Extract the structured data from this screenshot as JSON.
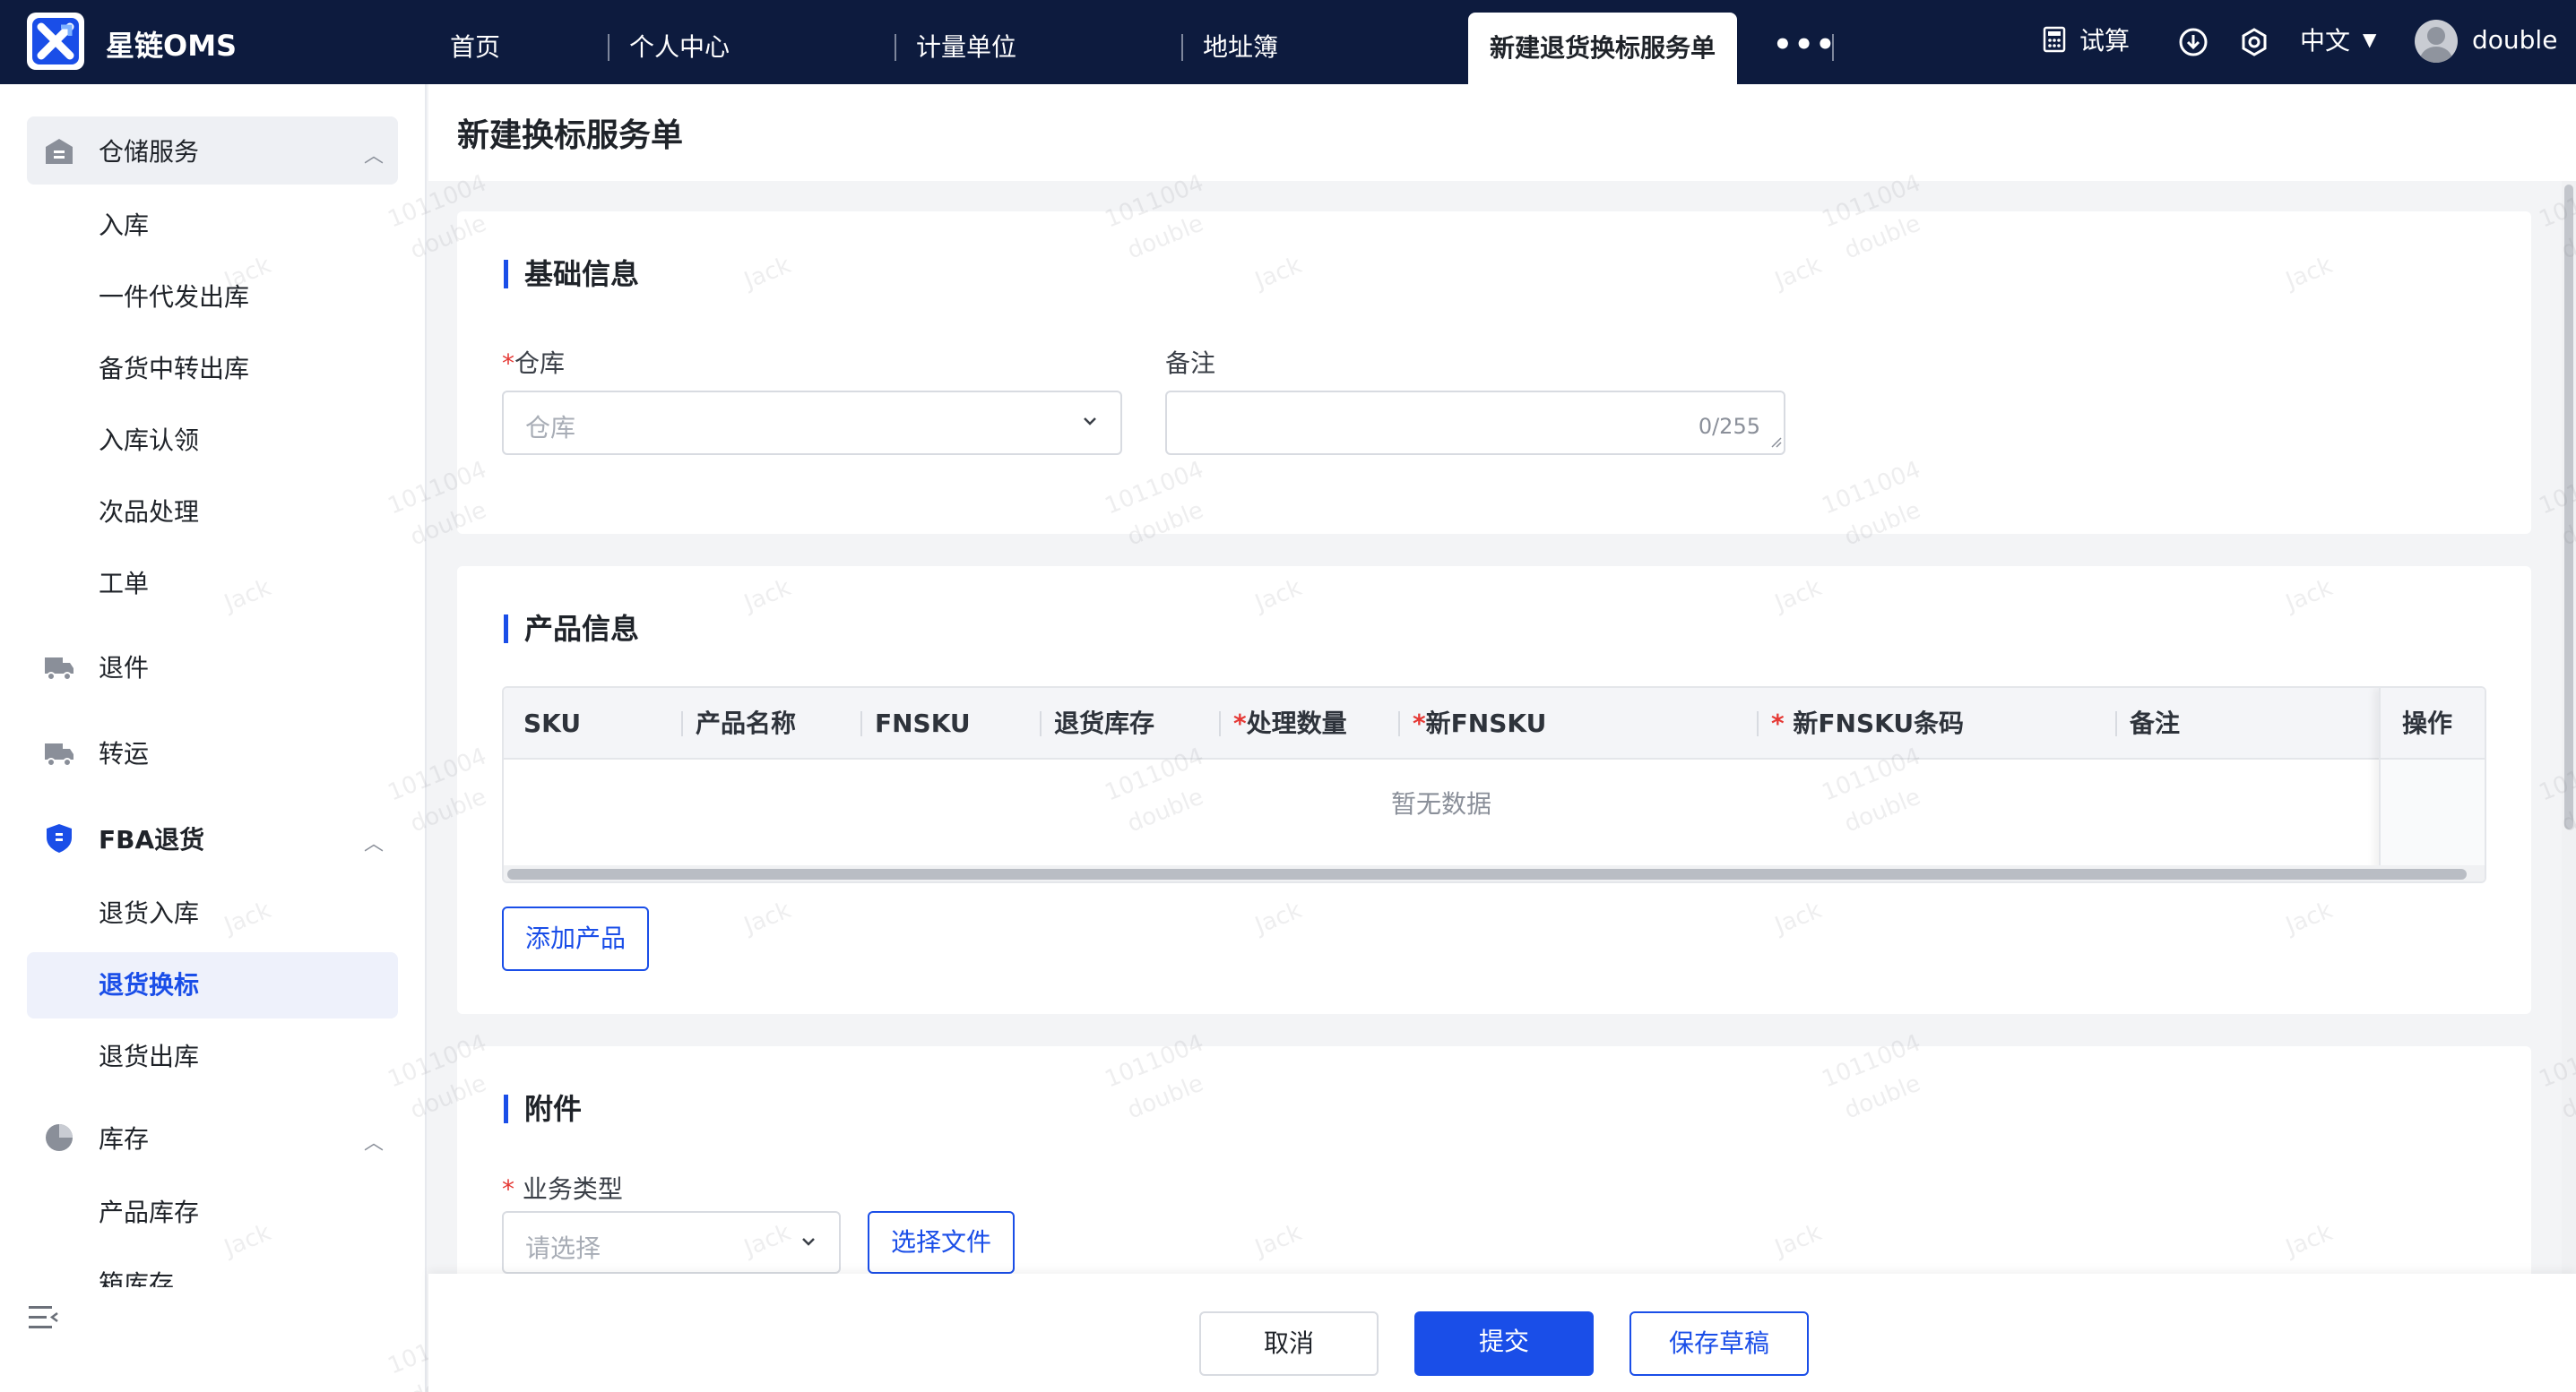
{
  "app": {
    "name": "星链OMS"
  },
  "nav": {
    "tabs": [
      "首页",
      "个人中心",
      "计量单位",
      "地址簿"
    ],
    "active_tab": "新建退货换标服务单",
    "more": "•••"
  },
  "topbar": {
    "calc_label": "试算",
    "language": "中文",
    "username": "double"
  },
  "sidebar": {
    "groups": [
      {
        "label": "仓储服务",
        "items": [
          "入库",
          "一件代发出库",
          "备货中转出库",
          "入库认领",
          "次品处理",
          "工单"
        ]
      },
      {
        "label": "退件"
      },
      {
        "label": "转运"
      },
      {
        "label": "FBA退货",
        "items": [
          "退货入库",
          "退货换标",
          "退货出库"
        ]
      },
      {
        "label": "库存",
        "items": [
          "产品库存",
          "箱库存"
        ]
      }
    ],
    "active_item": "退货换标"
  },
  "page": {
    "title": "新建换标服务单"
  },
  "basic": {
    "title": "基础信息",
    "warehouse_label": "仓库",
    "warehouse_placeholder": "仓库",
    "remark_label": "备注",
    "remark_counter": "0/255"
  },
  "product": {
    "title": "产品信息",
    "columns": [
      "SKU",
      "产品名称",
      "FNSKU",
      "退货库存",
      "处理数量",
      "新FNSKU",
      "新FNSKU条码",
      "备注",
      "操作"
    ],
    "empty_text": "暂无数据",
    "add_button": "添加产品"
  },
  "attachment": {
    "title": "附件",
    "type_label": "业务类型",
    "type_placeholder": "请选择",
    "file_button": "选择文件"
  },
  "footer": {
    "cancel": "取消",
    "submit": "提交",
    "save_draft": "保存草稿"
  },
  "watermark": {
    "line1": "1011004",
    "line2": "double",
    "line3": "Jack"
  },
  "colors": {
    "nav_bg": "#0d1b3e",
    "primary": "#1a4ee8",
    "required": "#e53935"
  }
}
